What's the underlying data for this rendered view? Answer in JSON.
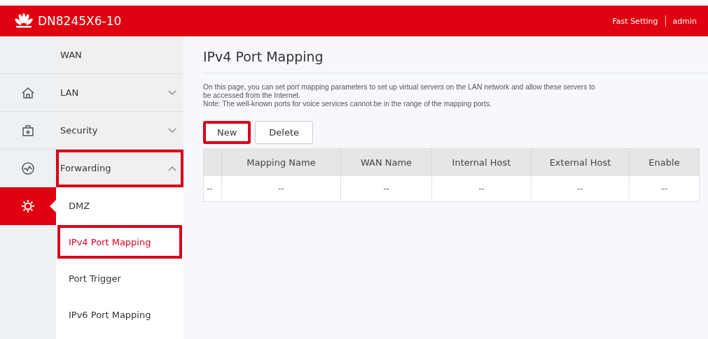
{
  "header": {
    "title": "DN8245X6-10",
    "links": [
      "Fast Setting",
      "admin"
    ]
  },
  "rail": [
    {
      "kind": "blank",
      "selected": false
    },
    {
      "kind": "home",
      "selected": false
    },
    {
      "kind": "toolbox",
      "selected": false
    },
    {
      "kind": "gauge",
      "selected": false
    },
    {
      "kind": "gear",
      "selected": true
    }
  ],
  "menu": [
    {
      "label": "WAN",
      "highlighted": false
    },
    {
      "label": "LAN",
      "expanded": false,
      "highlighted": false
    },
    {
      "label": "Security",
      "expanded": false,
      "highlighted": false
    },
    {
      "label": "Forwarding",
      "expanded": true,
      "highlighted": true,
      "children": [
        {
          "label": "DMZ",
          "selected": false,
          "highlighted": false
        },
        {
          "label": "IPv4 Port Mapping",
          "selected": true,
          "highlighted": true
        },
        {
          "label": "Port Trigger",
          "selected": false,
          "highlighted": false
        },
        {
          "label": "IPv6 Port Mapping",
          "selected": false,
          "highlighted": false
        }
      ]
    }
  ],
  "page": {
    "title": "IPv4 Port Mapping",
    "description": [
      "On this page, you can set port mapping parameters to set up virtual servers on the LAN network and allow these servers to",
      "be accessed from the Internet.",
      "Note: The well-known ports for voice services cannot be in the range of the mapping ports."
    ],
    "buttons": [
      {
        "label": "New",
        "highlighted": true
      },
      {
        "label": "Delete",
        "highlighted": false
      }
    ],
    "table": {
      "columns": [
        "",
        "Mapping Name",
        "WAN Name",
        "Internal Host",
        "External Host",
        "Enable"
      ],
      "rows": [
        [
          "--",
          "--",
          "--",
          "--",
          "--",
          "--"
        ]
      ]
    }
  }
}
